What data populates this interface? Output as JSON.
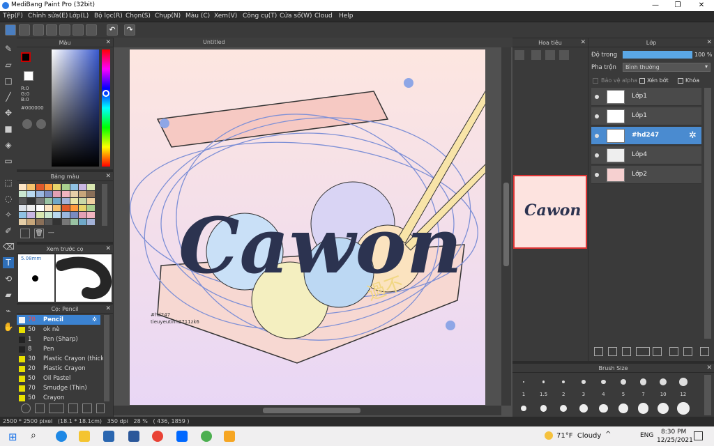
{
  "window": {
    "title": "MediBang Paint Pro (32bit)",
    "minimize": "—",
    "maximize": "❐",
    "close": "✕"
  },
  "menu": [
    "Tệp(F)",
    "Chỉnh sửa(E)",
    "Lớp(L)",
    "Bộ lọc(R)",
    "Chọn(S)",
    "Chụp(N)",
    "Màu (C)",
    "Xem(V)",
    "Công cụ(T)",
    "Cửa sổ(W)",
    "Cloud",
    "Help"
  ],
  "panels": {
    "color": {
      "title": "Màu",
      "r": "R:0",
      "g": "G:0",
      "b": "B:0",
      "hex": "#000000"
    },
    "palette": {
      "title": "Bảng màu",
      "dots": "---"
    },
    "preview": {
      "title": "Xem trước cọ",
      "size": "5.08mm"
    },
    "brush": {
      "title": "Cọ: Pencil",
      "items": [
        {
          "size": "70",
          "name": "Pencil",
          "color": "#f5f5f5"
        },
        {
          "size": "50",
          "name": "ok nè",
          "color": "#e8e000"
        },
        {
          "size": "1",
          "name": "Pen (Sharp)",
          "color": "#222222"
        },
        {
          "size": "8",
          "name": "Pen",
          "color": "#222222"
        },
        {
          "size": "30",
          "name": "Plastic Crayon (thick)",
          "color": "#e8e000"
        },
        {
          "size": "20",
          "name": "Plastic Crayon",
          "color": "#e8e000"
        },
        {
          "size": "50",
          "name": "Oil Pastel",
          "color": "#e8e000"
        },
        {
          "size": "70",
          "name": "Smudge (Thin)",
          "color": "#e8e000"
        },
        {
          "size": "50",
          "name": "Crayon",
          "color": "#e8e000"
        }
      ]
    },
    "navigator": {
      "title": "Hoa tiêu"
    },
    "layer": {
      "title": "Lớp",
      "opacity_label": "Độ trong",
      "opacity_value": "100 %",
      "opacity": 1.0,
      "blend_label": "Pha trộn",
      "blend_value": "Bình thường",
      "protect_alpha": "Bảo vệ alpha",
      "clip": "Xén bớt",
      "lock": "Khóa",
      "layers": [
        {
          "name": "Lớp1",
          "selected": false
        },
        {
          "name": "Lớp1",
          "selected": false
        },
        {
          "name": "#hd247",
          "selected": true
        },
        {
          "name": "Lớp4",
          "selected": false
        },
        {
          "name": "Lớp2",
          "selected": false
        }
      ]
    },
    "brushsize": {
      "title": "Brush Size",
      "sizes": [
        "1",
        "1.5",
        "2",
        "3",
        "4",
        "5",
        "7",
        "10",
        "12"
      ]
    }
  },
  "canvas": {
    "tab": "Untitled",
    "art_text": "Cawon",
    "watermark_cn": "過不",
    "credit_line1": "#hd247",
    "credit_line2": "tieuyeutinh2711zk6"
  },
  "status": {
    "text": "2500 * 2500 pixel   (18.1 * 18.1cm)   350 dpi   28 %   ( 436, 1859 )"
  },
  "taskbar": {
    "weather": "71°F  Cloudy",
    "lang": "ENG",
    "time": "8:30 PM",
    "date": "12/25/2021"
  }
}
